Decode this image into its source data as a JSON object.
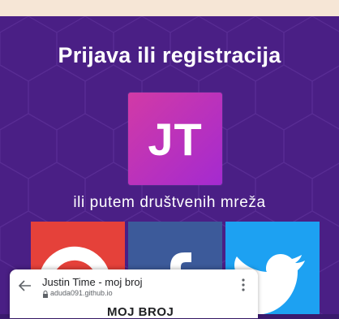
{
  "login": {
    "title": "Prijava ili registracija",
    "logo_text": "JT",
    "social_prompt": "ili putem društvenih mreža",
    "providers": [
      {
        "name": "Google",
        "icon": "google-icon",
        "color": "#e5413a"
      },
      {
        "name": "Facebook",
        "icon": "facebook-icon",
        "color": "#3c5a9a"
      },
      {
        "name": "Twitter",
        "icon": "twitter-icon",
        "color": "#1da1f2"
      }
    ]
  },
  "browser_sheet": {
    "page_title": "Justin Time - moj broj",
    "url": "aduda091.github.io",
    "content_heading": "MOJ BROJ"
  },
  "colors": {
    "background": "#4a1f85",
    "logo_gradient_start": "#d23aa6",
    "logo_gradient_end": "#a42ad0",
    "top_strip": "#f6e6d6"
  }
}
